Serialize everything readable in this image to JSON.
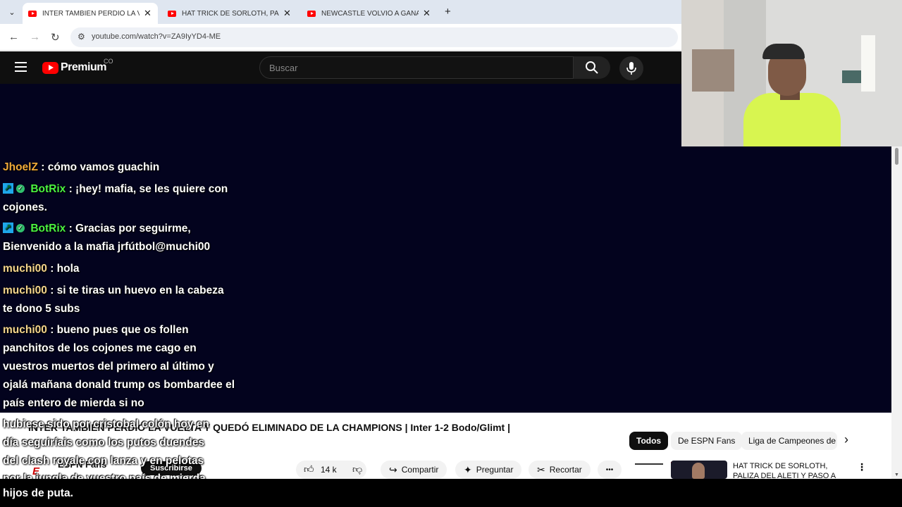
{
  "browser": {
    "tabs": [
      {
        "title": "INTER TAMBIÉN PERDIÓ LA VU",
        "active": true
      },
      {
        "title": "HAT TRICK DE SORLOTH, PALIZ",
        "active": false
      },
      {
        "title": "NEWCASTLE VOLVIÓ A GANAR",
        "active": false
      }
    ],
    "new_tab_symbol": "+",
    "url": "youtube.com/watch?v=ZA9IyYD4-ME"
  },
  "youtube": {
    "logo_text": "Premium",
    "country_code": "CO",
    "search_placeholder": "Buscar"
  },
  "chat": {
    "messages": [
      {
        "user": "JhoelZ",
        "text": ": cómo vamos guachin",
        "color": "#f0a93a"
      },
      {
        "user": "BotRix",
        "text": ": ¡hey! mafia, se les quiere con cojones.",
        "color": "#4af241",
        "badges": true
      },
      {
        "user": "BotRix",
        "text": ": Gracias por seguirme, Bienvenido a la mafia jrfútbol@muchi00",
        "color": "#4af241",
        "badges": true
      },
      {
        "user": "muchi00",
        "text": ": hola",
        "color": "#f3d48c"
      },
      {
        "user": "muchi00",
        "text": ": si te tiras un huevo en la cabeza te dono 5 subs",
        "color": "#f3d48c"
      },
      {
        "user": "muchi00",
        "text": ": bueno pues que os follen panchitos de los cojones me cago en vuestros muertos del primero al último y ojalá mañana donald trump os bombardee el país entero de mierda si no",
        "color": "#f3d48c"
      }
    ]
  },
  "caption": {
    "lines": [
      "hubiese sido por cristobal colón hoy en",
      "día seguiríais como los putos duendes",
      "del clash royale con lanza y en pelotas",
      "por la jungla de vuestro país de mierda"
    ],
    "last_line": "hijos de puta."
  },
  "video": {
    "title": "INTER TAMBIÉN PERDIÓ LA VUELTA Y QUEDÓ ELIMINADO DE LA CHAMPIONS | Inter 1-2 Bodo/Glimt |",
    "channel_logo": "E",
    "channel": "ESPN Fans",
    "subscribe_label": "Suscribirse",
    "likes": "14 k",
    "share_label": "Compartir",
    "ask_label": "Preguntar",
    "clip_label": "Recortar",
    "more_label": "•••"
  },
  "chips": [
    "Todos",
    "De ESPN Fans",
    "Liga de Campeones de"
  ],
  "recommendation": {
    "title": "HAT TRICK DE SORLOTH, PALIZA DEL ALETI Y PASO A"
  }
}
